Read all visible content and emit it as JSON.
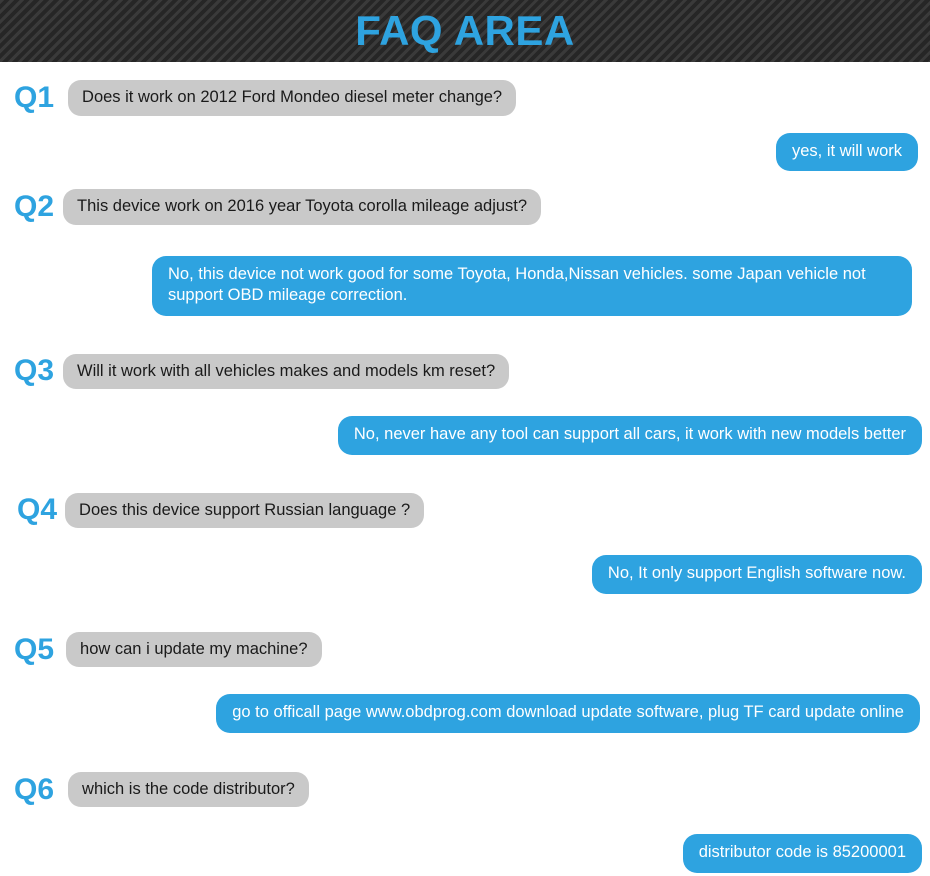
{
  "banner": {
    "title": "FAQ AREA"
  },
  "faq": [
    {
      "label": "Q1",
      "question": "Does it work on 2012 Ford Mondeo diesel meter change?",
      "answer": "yes, it will work"
    },
    {
      "label": "Q2",
      "question": "This device work on 2016 year Toyota corolla mileage adjust?",
      "answer": "No, this device not work good for some Toyota, Honda,Nissan vehicles. some Japan vehicle not support OBD mileage correction."
    },
    {
      "label": "Q3",
      "question": "Will it work with all vehicles makes and models km reset?",
      "answer": "No, never have any tool can support all cars, it work with new models better"
    },
    {
      "label": "Q4",
      "question": "Does this device support Russian language ?",
      "answer": "No, It only support English software now."
    },
    {
      "label": "Q5",
      "question": "how can i update my machine?",
      "answer": "go to officall page www.obdprog.com download update software, plug TF card update online"
    },
    {
      "label": "Q6",
      "question": "which is the code distributor?",
      "answer": "distributor code is 85200001"
    }
  ],
  "colors": {
    "accent": "#2ea3e0",
    "question_bubble": "#c9c9c9",
    "banner_bg": "#2b2b2b"
  }
}
